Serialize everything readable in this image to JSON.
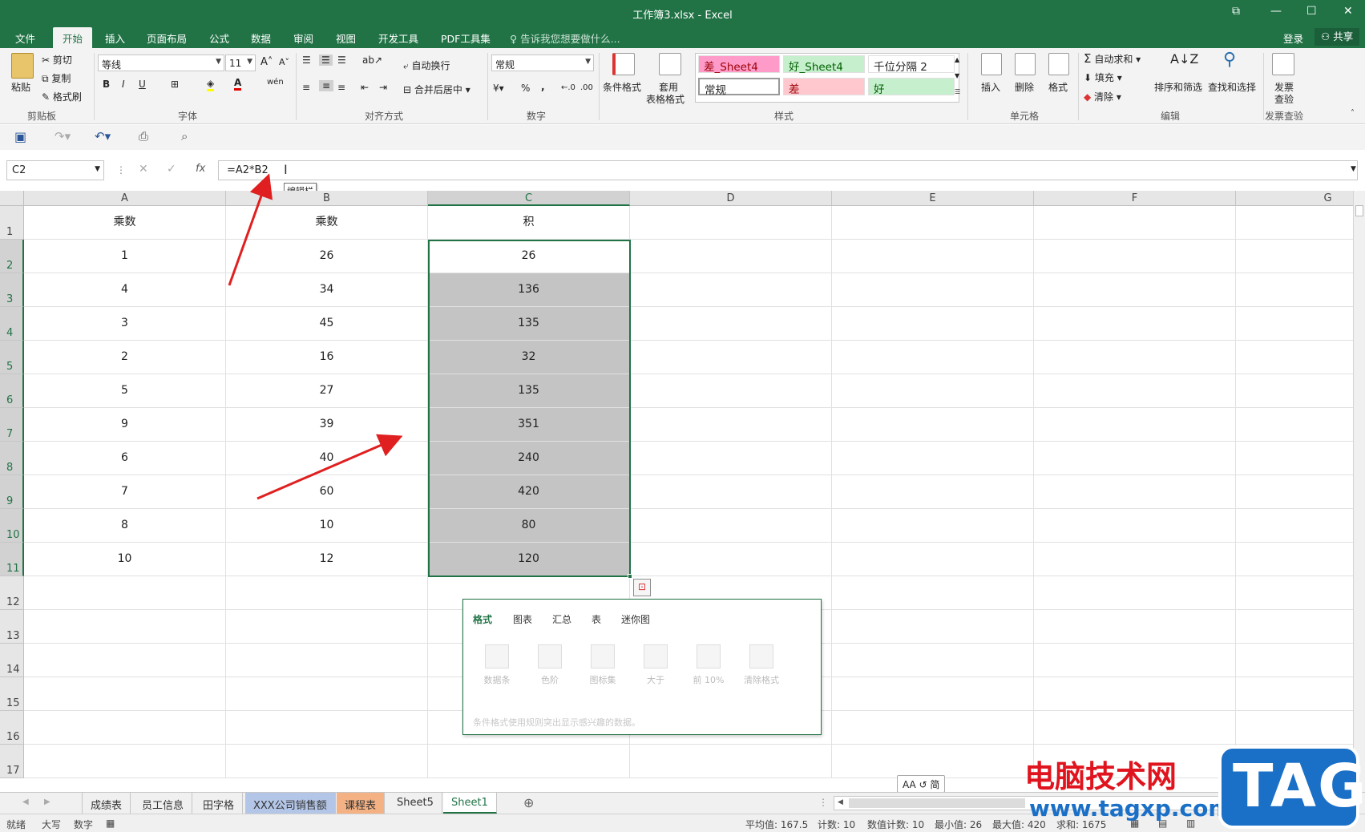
{
  "window": {
    "title": "工作簿3.xlsx - Excel"
  },
  "menu": {
    "items": [
      "文件",
      "开始",
      "插入",
      "页面布局",
      "公式",
      "数据",
      "审阅",
      "视图",
      "开发工具",
      "PDF工具集"
    ],
    "active": "开始",
    "tellme": "告诉我您想要做什么...",
    "login": "登录",
    "share": "共享"
  },
  "ribbon": {
    "clipboard": {
      "paste": "粘贴",
      "cut": "剪切",
      "copy": "复制",
      "format_painter": "格式刷",
      "label": "剪贴板"
    },
    "font": {
      "name": "等线",
      "size": "11",
      "label": "字体",
      "bold": "B",
      "italic": "I",
      "underline": "U"
    },
    "align": {
      "wrap": "自动换行",
      "merge": "合并后居中",
      "label": "对齐方式"
    },
    "number": {
      "format": "常规",
      "label": "数字"
    },
    "styles": {
      "cond": "条件格式",
      "table": "套用",
      "table2": "表格格式",
      "label": "样式",
      "cells": [
        "差_Sheet4",
        "好_Sheet4",
        "千位分隔 2",
        "常规",
        "差",
        "好"
      ]
    },
    "cells": {
      "insert": "插入",
      "delete": "删除",
      "format": "格式",
      "label": "单元格"
    },
    "edit": {
      "autosum": "自动求和",
      "fill": "填充",
      "clear": "清除",
      "sort": "排序和筛选",
      "find": "查找和选择",
      "label": "编辑"
    },
    "invoice": {
      "line1": "发票",
      "line2": "查验",
      "label": "发票查验"
    }
  },
  "formula_bar": {
    "name_box": "C2",
    "formula": "=A2*B2",
    "tooltip": "编辑栏",
    "fx": "fx"
  },
  "columns": [
    "A",
    "B",
    "C",
    "D",
    "E",
    "F",
    "G"
  ],
  "rows": [
    [
      "乘数",
      "乘数",
      "积"
    ],
    [
      "1",
      "26",
      "26"
    ],
    [
      "4",
      "34",
      "136"
    ],
    [
      "3",
      "45",
      "135"
    ],
    [
      "2",
      "16",
      "32"
    ],
    [
      "5",
      "27",
      "135"
    ],
    [
      "9",
      "39",
      "351"
    ],
    [
      "6",
      "40",
      "240"
    ],
    [
      "7",
      "60",
      "420"
    ],
    [
      "8",
      "10",
      "80"
    ],
    [
      "10",
      "12",
      "120"
    ]
  ],
  "row_numbers": [
    "1",
    "2",
    "3",
    "4",
    "5",
    "6",
    "7",
    "8",
    "9",
    "10",
    "11",
    "12",
    "13",
    "14",
    "15",
    "16",
    "17"
  ],
  "quick_analysis": {
    "tabs": [
      "格式",
      "图表",
      "汇总",
      "表",
      "迷你图"
    ],
    "items": [
      "数据条",
      "色阶",
      "图标集",
      "大于",
      "前 10%",
      "清除格式"
    ],
    "desc": "条件格式使用规则突出显示感兴趣的数据。"
  },
  "sheets": [
    "成绩表",
    "员工信息",
    "田字格",
    "XXX公司销售额",
    "课程表",
    "Sheet5",
    "Sheet1"
  ],
  "active_sheet": "Sheet1",
  "status": {
    "ready": "就绪",
    "caps": "大写",
    "num": "数字",
    "avg": "平均值: 167.5",
    "count": "计数: 10",
    "numcount": "数值计数: 10",
    "min": "最小值: 26",
    "max": "最大值: 420",
    "sum": "求和: 1675"
  },
  "aa_label": "AA ↺ 简",
  "watermark": {
    "cn": "电脑技术网",
    "url": "www.tagxp.com",
    "tag": "TAG"
  },
  "colors": {
    "excel_green": "#217346",
    "arrow_red": "#e02020",
    "style_bad": "#ff9bc8",
    "style_good": "#c6efce"
  }
}
